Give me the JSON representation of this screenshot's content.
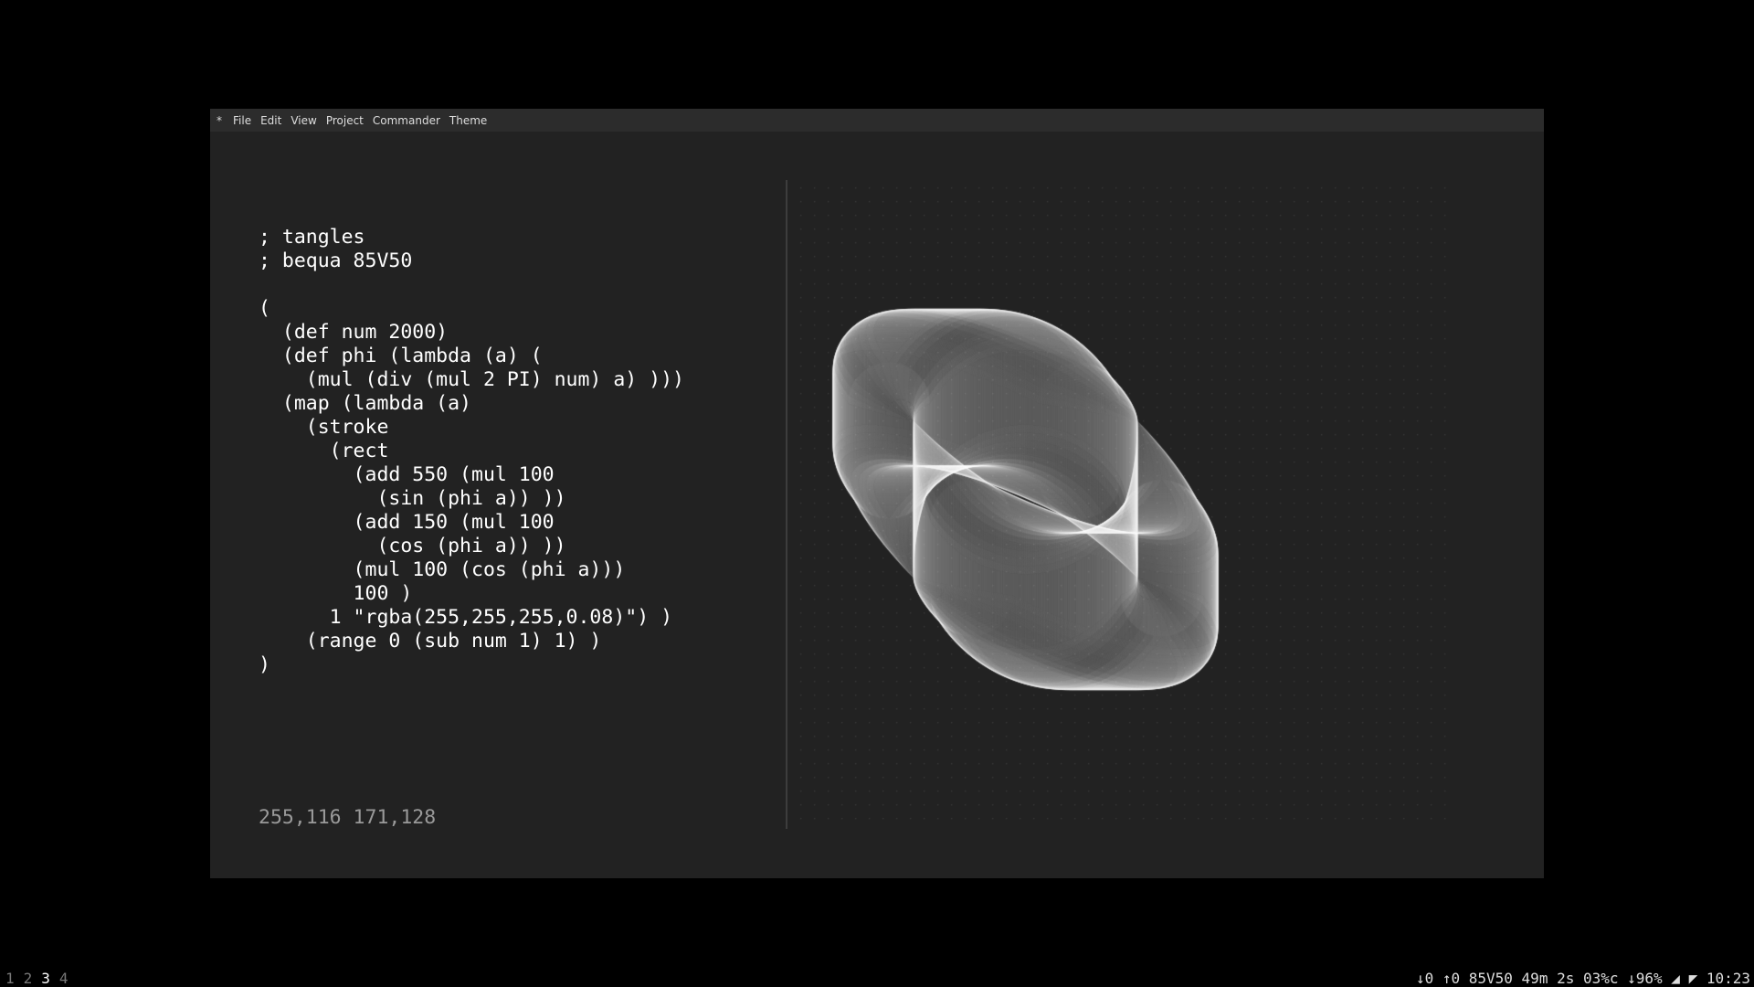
{
  "menu": {
    "star": "*",
    "items": [
      "File",
      "Edit",
      "View",
      "Project",
      "Commander",
      "Theme"
    ]
  },
  "editor": {
    "code": "; tangles\n; bequa 85V50\n\n(\n  (def num 2000)\n  (def phi (lambda (a) (\n    (mul (div (mul 2 PI) num) a) )))\n  (map (lambda (a)\n    (stroke\n      (rect\n        (add 550 (mul 100\n          (sin (phi a)) ))\n        (add 150 (mul 100\n          (cos (phi a)) ))\n        (mul 100 (cos (phi a)))\n        100 )\n      1 \"rgba(255,255,255,0.08)\") )\n    (range 0 (sub num 1) 1) )\n)",
    "status": "255,116 171,128"
  },
  "canvas": {
    "background": "#222222",
    "grid_dot_color": "#3a3a3a",
    "stroke_color": "rgba(255,255,255,0.08)"
  },
  "taskbar": {
    "workspaces": [
      "1",
      "2",
      "3",
      "4"
    ],
    "active_workspace": "3",
    "status": "↓0 ↑0 85V50 49m 2s 03%c ↓96% ◢ ◤ 10:23"
  }
}
